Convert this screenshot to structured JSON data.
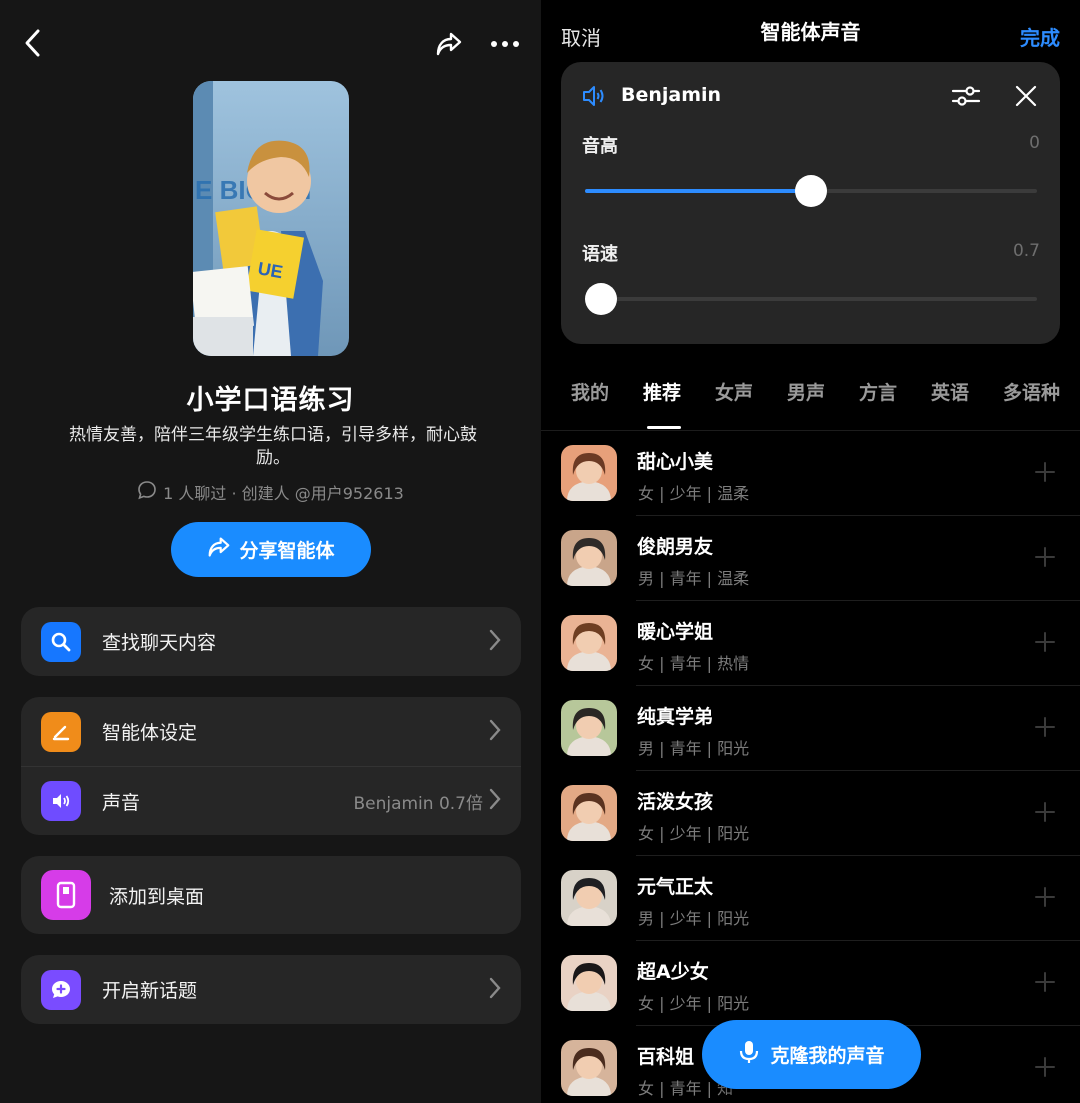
{
  "left": {
    "agent": {
      "name": "小学口语练习",
      "description": "热情友善，陪伴三年级学生练口语，引导多样，耐心鼓励。",
      "meta": "1 人聊过 · 创建人 @用户952613"
    },
    "share_button": "分享智能体",
    "menu": {
      "search_chat": "查找聊天内容",
      "agent_settings": "智能体设定",
      "voice": "声音",
      "voice_value": "Benjamin 0.7倍",
      "add_to_desktop": "添加到桌面",
      "new_topic": "开启新话题"
    },
    "cover_text": "E BIG Vol"
  },
  "right": {
    "cancel": "取消",
    "title": "智能体声音",
    "done": "完成",
    "current_voice": "Benjamin",
    "pitch": {
      "label": "音高",
      "value": "0",
      "level": 0.5
    },
    "speed": {
      "label": "语速",
      "value": "0.7",
      "level": 0.0
    },
    "tabs": [
      "我的",
      "推荐",
      "女声",
      "男声",
      "方言",
      "英语",
      "多语种"
    ],
    "active_tab": 1,
    "voices": [
      {
        "name": "甜心小美",
        "tags": "女 | 少年 | 温柔"
      },
      {
        "name": "俊朗男友",
        "tags": "男 | 青年 | 温柔"
      },
      {
        "name": "暖心学姐",
        "tags": "女 | 青年 | 热情"
      },
      {
        "name": "纯真学弟",
        "tags": "男 | 青年 | 阳光"
      },
      {
        "name": "活泼女孩",
        "tags": "女 | 少年 | 阳光"
      },
      {
        "name": "元气正太",
        "tags": "男 | 少年 | 阳光"
      },
      {
        "name": "超A少女",
        "tags": "女 | 少年 | 阳光"
      },
      {
        "name": "百科姐",
        "tags": "女 | 青年 | 知"
      }
    ],
    "clone_button": "克隆我的声音"
  },
  "colors": {
    "accent": "#1a8cff",
    "search_icon_bg": "#1677ff",
    "settings_icon_bg": "#f08c1a",
    "voice_icon_bg": "#6f4cff",
    "desktop_icon_bg": "#d63ce8",
    "topic_icon_bg": "#7a4cff"
  }
}
